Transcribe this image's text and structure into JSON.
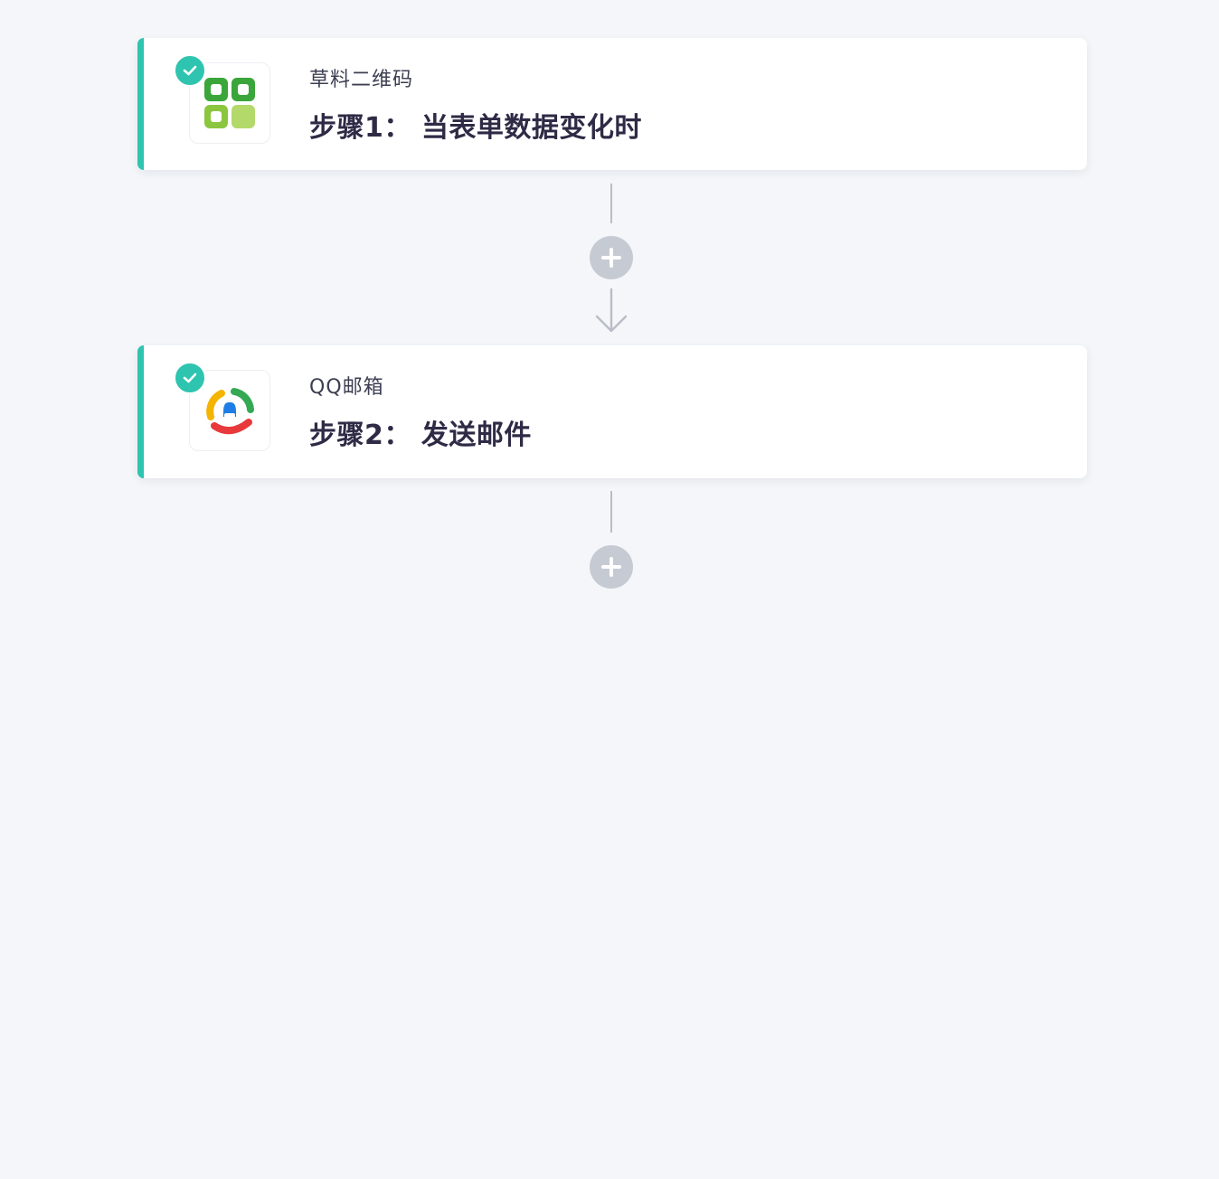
{
  "steps": [
    {
      "app_name": "草料二维码",
      "title": "步骤1： 当表单数据变化时",
      "icon": "caoliao-qrcode-icon",
      "status": "completed"
    },
    {
      "app_name": "QQ邮箱",
      "title": "步骤2： 发送邮件",
      "icon": "qq-mail-icon",
      "status": "completed"
    }
  ],
  "colors": {
    "accent": "#2ec4b0",
    "background": "#f4f6f9",
    "connector": "#b9bdc6",
    "add_button": "#c6cad3",
    "title_text": "#2f2a45"
  },
  "icons": {
    "check": "check-icon",
    "add": "plus-icon",
    "arrow": "arrow-down-icon"
  }
}
